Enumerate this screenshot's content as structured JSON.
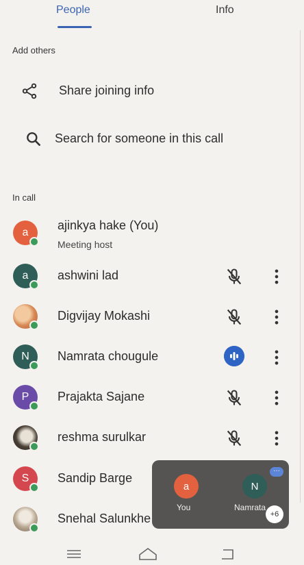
{
  "tabs": [
    {
      "label": "People"
    },
    {
      "label": "Info"
    }
  ],
  "add_others": {
    "section_label": "Add others",
    "share_label": "Share joining info",
    "search_label": "Search for someone in this call"
  },
  "in_call": {
    "section_label": "In call",
    "participants": [
      {
        "name": "ajinkya hake (You)",
        "subtitle": "Meeting host",
        "initial": "a"
      },
      {
        "name": "ashwini lad",
        "initial": "a"
      },
      {
        "name": "Digvijay Mokashi",
        "initial": ""
      },
      {
        "name": "Namrata chougule",
        "initial": "N"
      },
      {
        "name": "Prajakta Sajane",
        "initial": "P"
      },
      {
        "name": "reshma surulkar",
        "initial": ""
      },
      {
        "name": "Sandip Barge",
        "initial": "S"
      },
      {
        "name": "Snehal Salunkhe",
        "initial": ""
      }
    ]
  },
  "pip": {
    "tiles": [
      {
        "initial": "a",
        "label": "You"
      },
      {
        "initial": "N",
        "label": "Namrata"
      }
    ],
    "menu_label": "···",
    "more_count": "+6"
  },
  "colors": {
    "accent": "#3b63b3",
    "avatar_orange": "#e4613f",
    "avatar_teal": "#2f5d57",
    "avatar_purple": "#6a4ca8",
    "avatar_red": "#d5474f",
    "online": "#3c9a5a"
  }
}
